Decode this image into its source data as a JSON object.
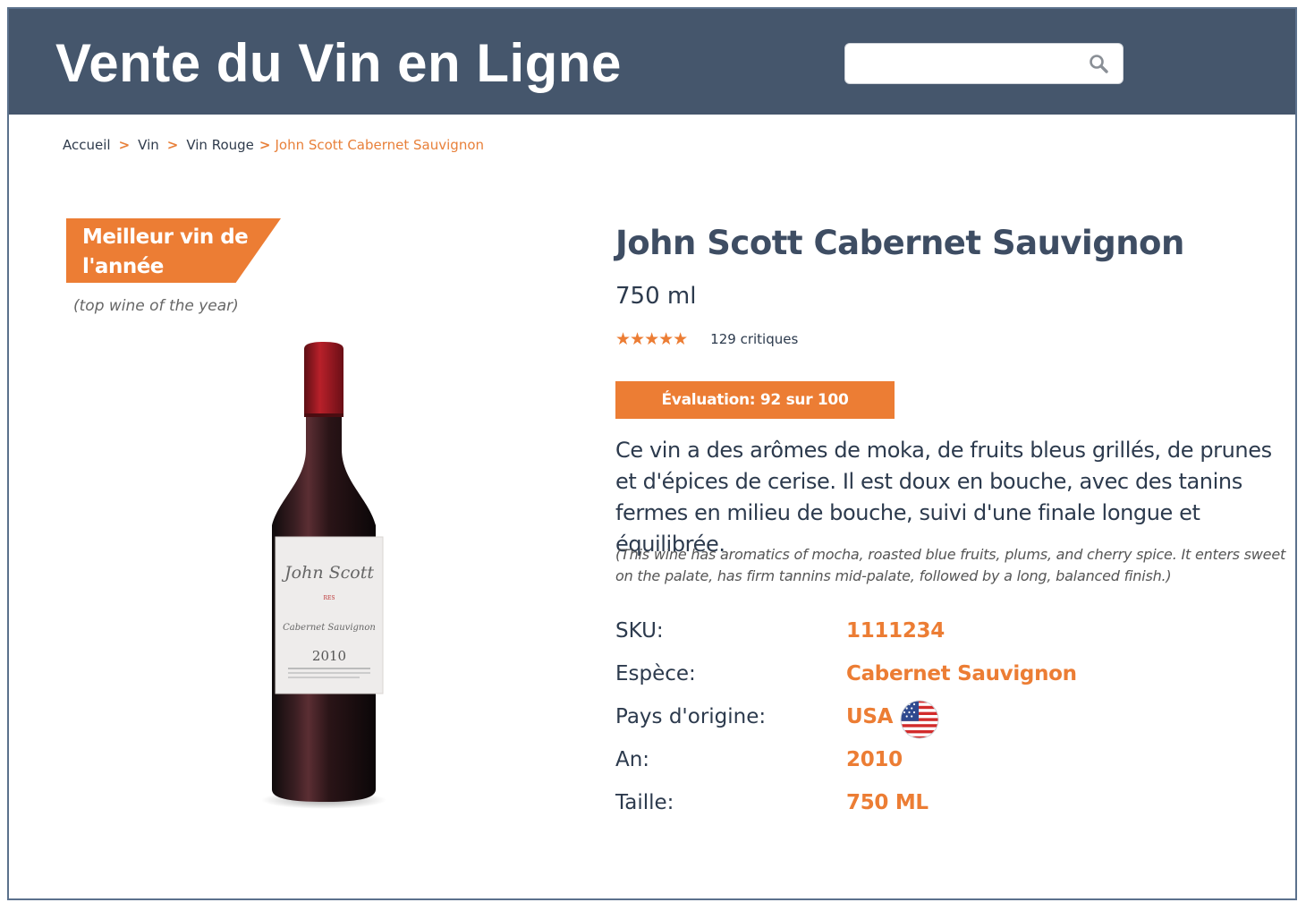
{
  "header": {
    "site_title": "Vente du Vin en Ligne",
    "search_placeholder": "",
    "search_icon": "search-icon"
  },
  "breadcrumb": {
    "items": [
      "Accueil",
      "Vin",
      "Vin Rouge",
      "John Scott Cabernet Sauvignon"
    ],
    "separator": ">"
  },
  "badge": {
    "label": "Meilleur vin de l'année",
    "subtitle": "(top wine of the year)"
  },
  "product": {
    "title": "John Scott Cabernet Sauvignon",
    "volume": "750 ml",
    "stars": "★★★★★",
    "star_rating": 5,
    "reviews": "129 critiques",
    "score": "Évaluation: 92 sur 100",
    "description_fr": "Ce vin a des arômes de moka, de fruits bleus grillés, de prunes et d'épices de cerise. Il est doux en bouche, avec des tanins fermes en milieu de bouche, suivi d'une finale longue et équilibrée.",
    "description_en": "(This wine has aromatics of mocha, roasted blue fruits, plums, and cherry spice. It enters sweet on the palate, has firm tannins mid-palate, followed by a long, balanced finish.)",
    "bottle_label": {
      "brand": "John Scott",
      "variety": "Cabernet Sauvignon",
      "year": "2010"
    }
  },
  "specs": [
    {
      "label": "SKU:",
      "value": "1111234"
    },
    {
      "label": "Espèce:",
      "value": "Cabernet Sauvignon"
    },
    {
      "label": "Pays d'origine:",
      "value": "USA",
      "icon": "us-flag-icon"
    },
    {
      "label": "An:",
      "value": "2010"
    },
    {
      "label": "Taille:",
      "value": "750 ML"
    }
  ],
  "colors": {
    "header_bg": "#45566c",
    "accent": "#ec7d34",
    "text_dark": "#2c3a4d",
    "title": "#3e4d63"
  }
}
